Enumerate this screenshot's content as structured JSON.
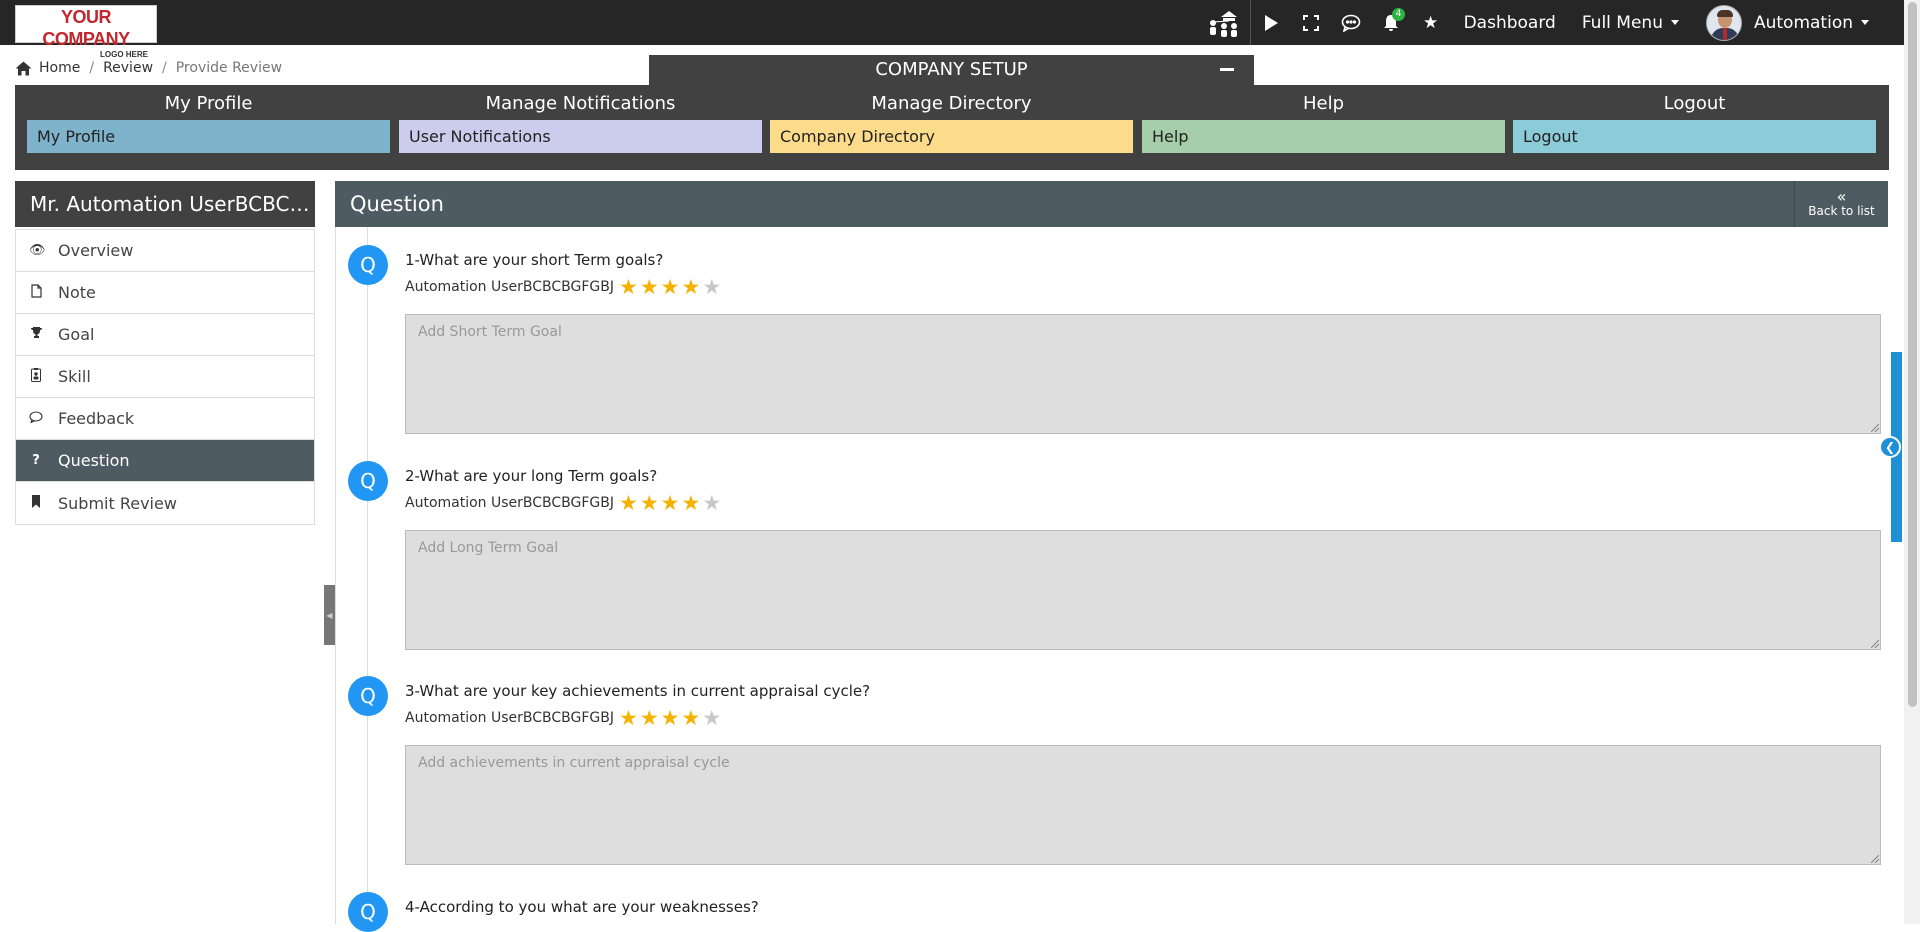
{
  "logo": {
    "line1": "YOUR COMPANY",
    "line2": "LOGO HERE"
  },
  "topnav": {
    "notification_count": "4",
    "dashboard_label": "Dashboard",
    "full_menu_label": "Full Menu",
    "user_label": "Automation"
  },
  "breadcrumb": {
    "home": "Home",
    "review": "Review",
    "current": "Provide Review"
  },
  "company_setup": {
    "title": "COMPANY SETUP",
    "columns": [
      {
        "heading": "My Profile",
        "button": "My Profile",
        "color": "#7fb3cb"
      },
      {
        "heading": "Manage Notifications",
        "button": "User Notifications",
        "color": "#cccdec"
      },
      {
        "heading": "Manage Directory",
        "button": "Company Directory",
        "color": "#fcdc8b"
      },
      {
        "heading": "Help",
        "button": "Help",
        "color": "#a6ceaa"
      },
      {
        "heading": "Logout",
        "button": "Logout",
        "color": "#8ccbd8"
      }
    ]
  },
  "sidebar": {
    "title": "Mr. Automation UserBCBCBGFGBJ",
    "items": [
      {
        "label": "Overview",
        "icon": "eye-icon"
      },
      {
        "label": "Note",
        "icon": "file-icon"
      },
      {
        "label": "Goal",
        "icon": "trophy-icon"
      },
      {
        "label": "Skill",
        "icon": "id-badge-icon"
      },
      {
        "label": "Feedback",
        "icon": "comment-icon"
      },
      {
        "label": "Question",
        "icon": "question-icon"
      },
      {
        "label": "Submit Review",
        "icon": "bookmark-icon"
      }
    ],
    "active_item": "Question"
  },
  "main": {
    "title": "Question",
    "back_label": "Back to list",
    "question_icon_letter": "Q",
    "questions": [
      {
        "title": "1-What are your short Term goals?",
        "user": "Automation UserBCBCBGFGBJ",
        "rating": 4,
        "rating_max": 5,
        "placeholder": "Add Short Term Goal"
      },
      {
        "title": "2-What are your long Term goals?",
        "user": "Automation UserBCBCBGFGBJ",
        "rating": 4,
        "rating_max": 5,
        "placeholder": "Add Long Term Goal"
      },
      {
        "title": "3-What are your key achievements in current appraisal cycle?",
        "user": "Automation UserBCBCBGFGBJ",
        "rating": 4,
        "rating_max": 5,
        "placeholder": "Add achievements in current appraisal cycle"
      },
      {
        "title": "4-According to you what are your weaknesses?"
      }
    ]
  },
  "colors": {
    "topbar": "#262626",
    "panel": "#414141",
    "header": "#4f5b63",
    "accent": "#2196f3",
    "star_on": "#f5b301",
    "star_off": "#c8c8c8",
    "logo_red": "#c0282d"
  }
}
